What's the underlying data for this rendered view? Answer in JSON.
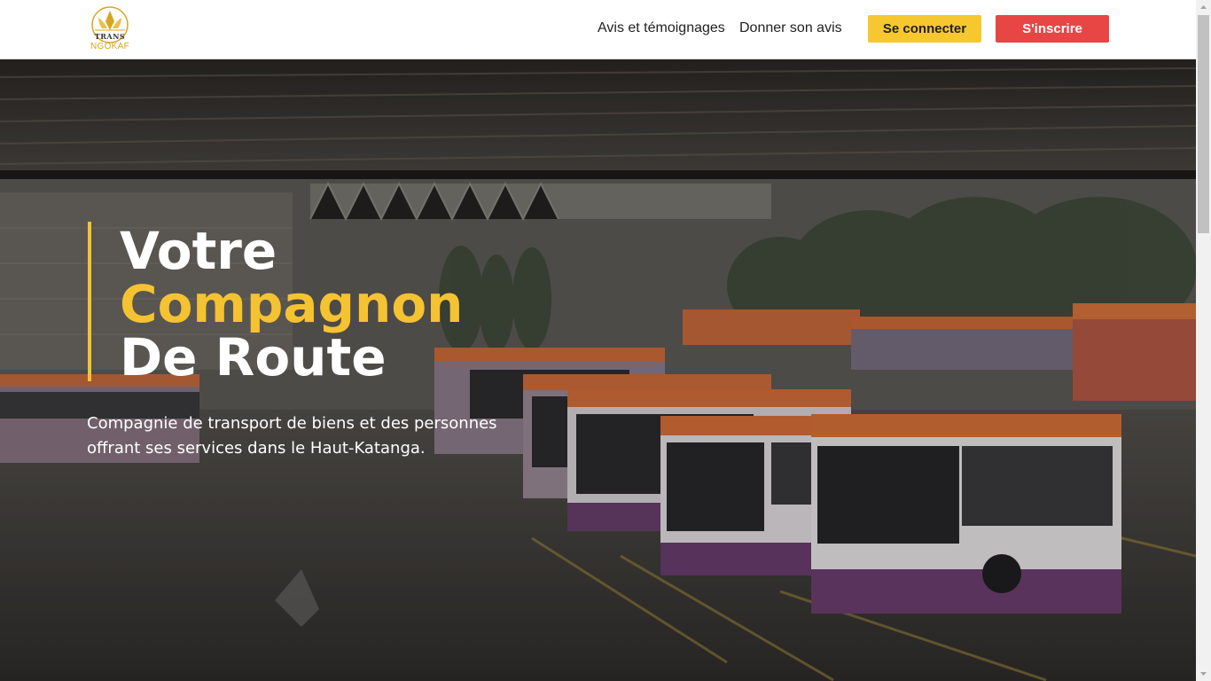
{
  "header": {
    "logo_top": "TRANS",
    "logo_bottom": "NGOKAF",
    "nav": {
      "reviews": "Avis et témoignages",
      "give_review": "Donner son avis"
    },
    "login_label": "Se connecter",
    "signup_label": "S'inscrire"
  },
  "hero": {
    "title_line1": "Votre",
    "title_line2": "Compagnon",
    "title_line3": "De Route",
    "subtitle": "Compagnie de transport de biens et des personnes offrant ses services dans le Haut-Katanga."
  },
  "colors": {
    "accent_yellow": "#f5c232",
    "signup_red": "#e84545",
    "login_yellow": "#f7c730"
  },
  "icons": {
    "logo": "trans-ngokaf-logo",
    "scroll_up": "chevron-up-icon",
    "scroll_down": "chevron-down-icon"
  }
}
